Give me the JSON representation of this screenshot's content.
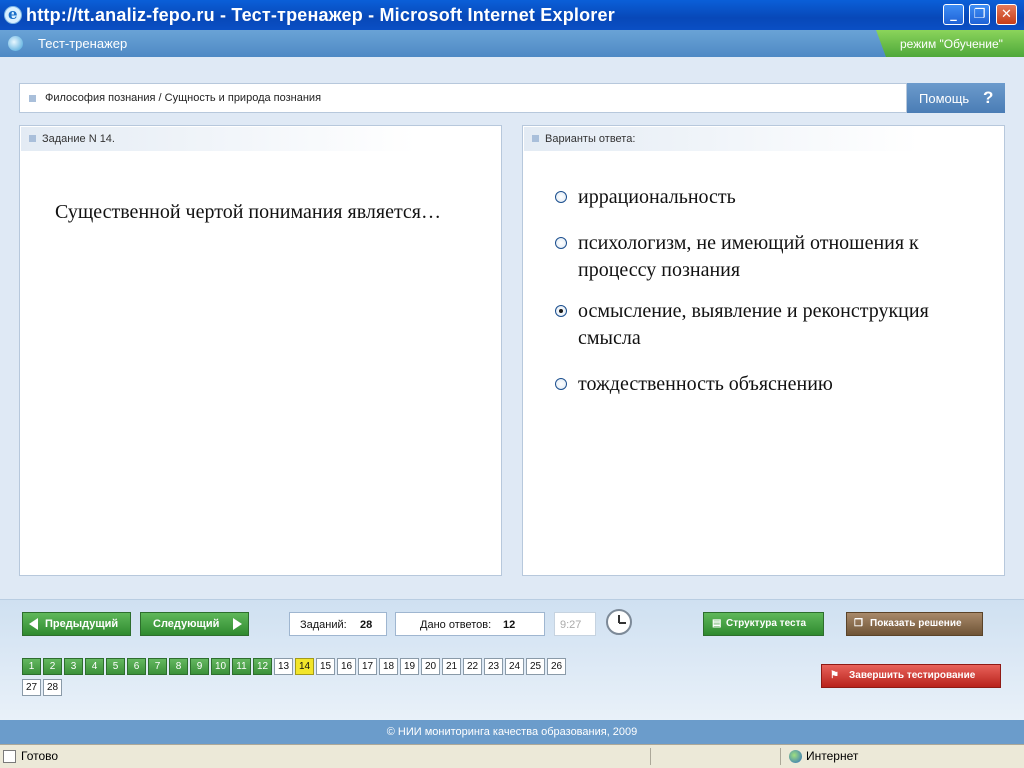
{
  "window": {
    "title": "http://tt.analiz-fepo.ru - Тест-тренажер - Microsoft Internet Explorer"
  },
  "app": {
    "title": "Тест-тренажер",
    "mode": "режим \"Обучение\""
  },
  "breadcrumb": "Философия познания / Сущность и природа познания",
  "help_label": "Помощь",
  "help_icon": "?",
  "question": {
    "header": "Задание N 14.",
    "text": "Существенной чертой понимания является…"
  },
  "answers": {
    "header": "Варианты ответа:",
    "options": [
      {
        "text": "иррациональность",
        "selected": false
      },
      {
        "text": "психологизм, не имеющий отношения к процессу познания",
        "selected": false
      },
      {
        "text": "осмысление, выявление и реконструкция смысла",
        "selected": true
      },
      {
        "text": "тождественность объяснению",
        "selected": false
      }
    ]
  },
  "nav": {
    "prev": "Предыдущий",
    "next": "Следующий",
    "tasks_label": "Заданий:",
    "tasks_count": "28",
    "answered_label": "Дано ответов:",
    "answered_count": "12",
    "timer": "9:27",
    "structure_btn": "Структура теста",
    "solution_btn": "Показать решение",
    "finish_btn": "Завершить тестирование"
  },
  "task_grid": {
    "numbers": [
      "1",
      "2",
      "3",
      "4",
      "5",
      "6",
      "7",
      "8",
      "9",
      "10",
      "11",
      "12",
      "13",
      "14",
      "15",
      "16",
      "17",
      "18",
      "19",
      "20",
      "21",
      "22",
      "23",
      "24",
      "25",
      "26",
      "27",
      "28"
    ],
    "answered_count": 12,
    "current": "14"
  },
  "footer": "© НИИ мониторинга качества образования, 2009",
  "statusbar": {
    "left": "Готово",
    "right": "Интернет"
  },
  "colors": {
    "accent": "#4e89c4",
    "answered": "#3b913a",
    "current": "#f2e52a",
    "mode_badge": "#4ea83a"
  }
}
